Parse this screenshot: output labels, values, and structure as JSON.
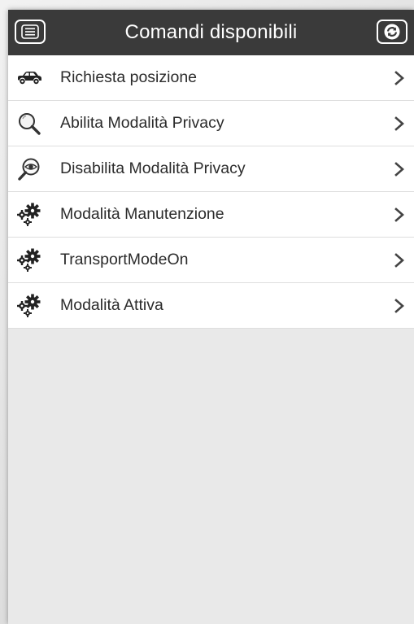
{
  "header": {
    "title": "Comandi disponibili",
    "menu_icon": "menu-icon",
    "refresh_icon": "refresh-icon"
  },
  "commands": [
    {
      "label": "Richiesta posizione",
      "icon": "car-icon"
    },
    {
      "label": "Abilita Modalità Privacy",
      "icon": "magnifier-icon"
    },
    {
      "label": "Disabilita Modalità Privacy",
      "icon": "eye-magnifier-icon"
    },
    {
      "label": "Modalità Manutenzione",
      "icon": "gears-icon"
    },
    {
      "label": "TransportModeOn",
      "icon": "gears-icon"
    },
    {
      "label": "Modalità Attiva",
      "icon": "gears-icon"
    }
  ],
  "colors": {
    "header_bg": "#3a3a3a",
    "list_bg": "#ffffff",
    "page_bg": "#e9e9e9",
    "text": "#2b2b2b"
  }
}
